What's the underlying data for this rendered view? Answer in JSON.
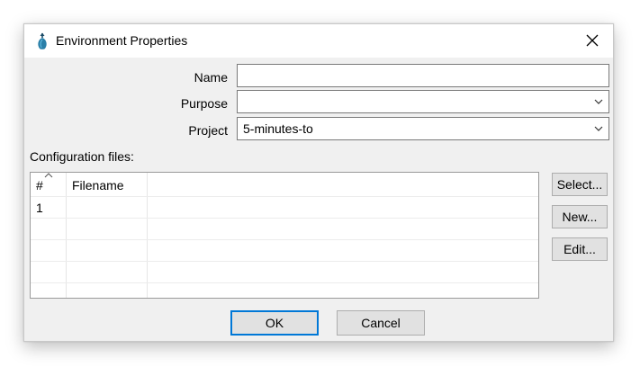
{
  "window": {
    "title": "Environment Properties",
    "icon": "app-logo-icon",
    "close_icon": "close-icon"
  },
  "form": {
    "name_label": "Name",
    "name_value": "",
    "purpose_label": "Purpose",
    "purpose_value": "",
    "project_label": "Project",
    "project_value": "5-minutes-to"
  },
  "config": {
    "section_label": "Configuration files:",
    "columns": [
      "#",
      "Filename"
    ],
    "rows": [
      {
        "index": "1",
        "filename": ""
      }
    ]
  },
  "side_buttons": {
    "select_label": "Select...",
    "new_label": "New...",
    "edit_label": "Edit..."
  },
  "footer": {
    "ok_label": "OK",
    "cancel_label": "Cancel"
  },
  "colors": {
    "accent": "#0078d7",
    "dialog_bg": "#f0f0f0",
    "button_bg": "#e1e1e1"
  }
}
